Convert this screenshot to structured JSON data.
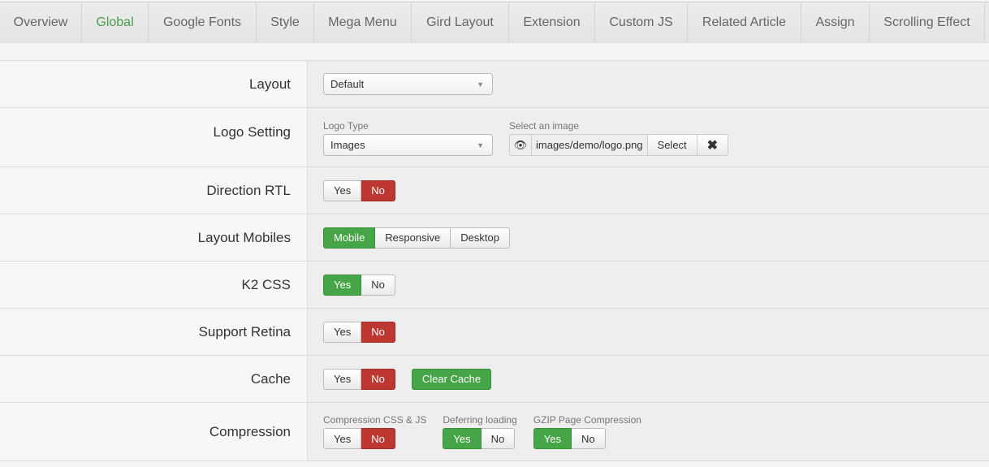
{
  "tabs": [
    {
      "label": "Overview",
      "active": false
    },
    {
      "label": "Global",
      "active": true
    },
    {
      "label": "Google Fonts",
      "active": false
    },
    {
      "label": "Style",
      "active": false
    },
    {
      "label": "Mega Menu",
      "active": false
    },
    {
      "label": "Gird Layout",
      "active": false
    },
    {
      "label": "Extension",
      "active": false
    },
    {
      "label": "Custom JS",
      "active": false
    },
    {
      "label": "Related Article",
      "active": false
    },
    {
      "label": "Assign",
      "active": false
    },
    {
      "label": "Scrolling Effect",
      "active": false
    }
  ],
  "form": {
    "layout": {
      "label": "Layout",
      "value": "Default"
    },
    "logo": {
      "label": "Logo Setting",
      "type_label": "Logo Type",
      "type_value": "Images",
      "image_label": "Select an image",
      "image_value": "images/demo/logo.png",
      "select": "Select",
      "clear_icon": "x-icon",
      "preview_icon": "eye-icon"
    },
    "rtl": {
      "label": "Direction RTL",
      "yes": "Yes",
      "no": "No",
      "selected": "No"
    },
    "mobiles": {
      "label": "Layout Mobiles",
      "mobile": "Mobile",
      "responsive": "Responsive",
      "desktop": "Desktop",
      "selected": "Mobile"
    },
    "k2": {
      "label": "K2 CSS",
      "yes": "Yes",
      "no": "No",
      "selected": "Yes"
    },
    "retina": {
      "label": "Support Retina",
      "yes": "Yes",
      "no": "No",
      "selected": "No"
    },
    "cache": {
      "label": "Cache",
      "yes": "Yes",
      "no": "No",
      "selected": "No",
      "clear": "Clear Cache"
    },
    "compression": {
      "label": "Compression",
      "css_js": {
        "label": "Compression CSS & JS",
        "yes": "Yes",
        "no": "No",
        "selected": "No"
      },
      "defer": {
        "label": "Deferring loading",
        "yes": "Yes",
        "no": "No",
        "selected": "Yes"
      },
      "gzip": {
        "label": "GZIP Page Compression",
        "yes": "Yes",
        "no": "No",
        "selected": "Yes"
      }
    }
  },
  "colors": {
    "active_tab": "#4a9c4a",
    "yes_active": "#46a546",
    "no_active": "#bd362f"
  }
}
